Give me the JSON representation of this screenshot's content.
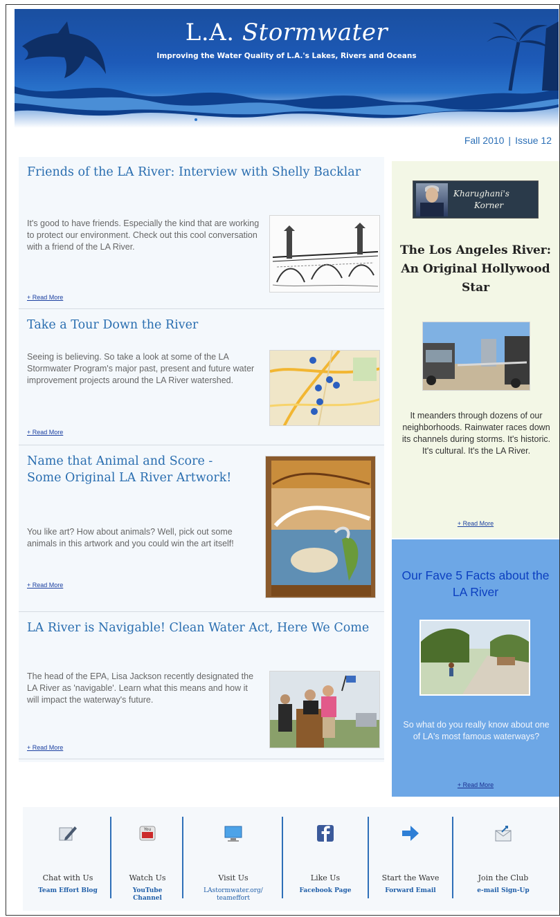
{
  "header": {
    "title_plain": "L.A. ",
    "title_italic": "Stormwater",
    "tagline": "Improving the Water Quality of L.A.'s Lakes, Rivers and Oceans"
  },
  "issue": {
    "season": "Fall 2010",
    "separator": "|",
    "number": "Issue 12"
  },
  "articles": [
    {
      "title": "Friends of the LA River: Interview with Shelly Backlar",
      "body": "It's good to have friends. Especially the kind that are working to protect our environment. Check out this cool conversation with a friend of the LA River.",
      "read_more": "+ Read More",
      "image": "bridge-sketch"
    },
    {
      "title": "Take a Tour Down the River",
      "body": "Seeing is believing. So take a look at some of the LA Stormwater Program's major past, present and future water improvement projects around the LA River watershed.",
      "read_more": "+ Read More",
      "image": "map-with-pins"
    },
    {
      "title": "Name that Animal and Score - Some Original LA River Artwork!",
      "body": "You like art? How about animals? Well, pick out some animals in this artwork and you could win the art itself!",
      "read_more": "+ Read More",
      "image": "artwork-poster"
    },
    {
      "title": "LA River is Navigable! Clean Water Act, Here We Come",
      "body": "The head of the EPA, Lisa Jackson recently designated the LA River as 'navigable'. Learn what this means and how it will impact the waterway's future.",
      "read_more": "+ Read More",
      "image": "podium-photo"
    }
  ],
  "sidebar": {
    "korner": {
      "badge_line1": "Kharughani's",
      "badge_line2": "Korner",
      "title": "The Los Angeles River: An Original Hollywood Star",
      "body": "It meanders through dozens of our neighborhoods. Rainwater races down its channels during storms. It's historic. It's cultural. It's the LA River.",
      "read_more": "+ Read More"
    },
    "facts": {
      "title": "Our Fave 5 Facts about the LA River",
      "body": "So what do you really know about one of LA's most famous waterways?",
      "read_more": "+ Read More"
    }
  },
  "footer": [
    {
      "label": "Chat with Us",
      "sub": "Team Effort Blog",
      "icon": "pencil-icon"
    },
    {
      "label": "Watch Us",
      "sub": "YouTube Channel",
      "icon": "youtube-icon"
    },
    {
      "label": "Visit Us",
      "sub": "LAstormwater.org/ teameffort",
      "icon": "monitor-icon"
    },
    {
      "label": "Like Us",
      "sub": "Facebook Page",
      "icon": "facebook-icon"
    },
    {
      "label": "Start the Wave",
      "sub": "Forward Email",
      "icon": "arrow-icon"
    },
    {
      "label": "Join the Club",
      "sub": "e-mail Sign-Up",
      "icon": "mail-icon"
    }
  ],
  "colors": {
    "header_blue": "#1d5ab8",
    "headline_blue": "#2a6eb0",
    "korner_bg": "#f3f7e6",
    "facts_bg": "#6da7e6",
    "link": "#1a3fa0"
  }
}
